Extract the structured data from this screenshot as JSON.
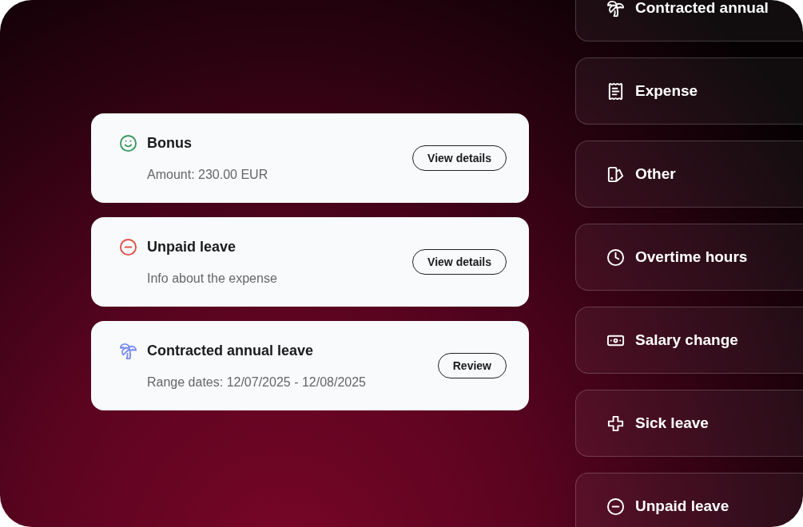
{
  "requests": [
    {
      "kind": "smile",
      "color": "#3c9a5f",
      "title": "Bonus",
      "detail": "Amount: 230.00 EUR",
      "action": "View details"
    },
    {
      "kind": "minus",
      "color": "#e0524a",
      "title": "Unpaid leave",
      "detail": "Info about the expense",
      "action": "View details"
    },
    {
      "kind": "palm",
      "color": "#7b8cf0",
      "title": "Contracted annual leave",
      "detail": "Range dates: 12/07/2025 - 12/08/2025",
      "action": "Review"
    }
  ],
  "categories": [
    {
      "kind": "palm",
      "label": "Contracted annual"
    },
    {
      "kind": "receipt",
      "label": "Expense"
    },
    {
      "kind": "other",
      "label": "Other"
    },
    {
      "kind": "clock",
      "label": "Overtime hours"
    },
    {
      "kind": "money",
      "label": "Salary change"
    },
    {
      "kind": "cross",
      "label": "Sick leave"
    },
    {
      "kind": "minus",
      "label": "Unpaid leave"
    }
  ]
}
